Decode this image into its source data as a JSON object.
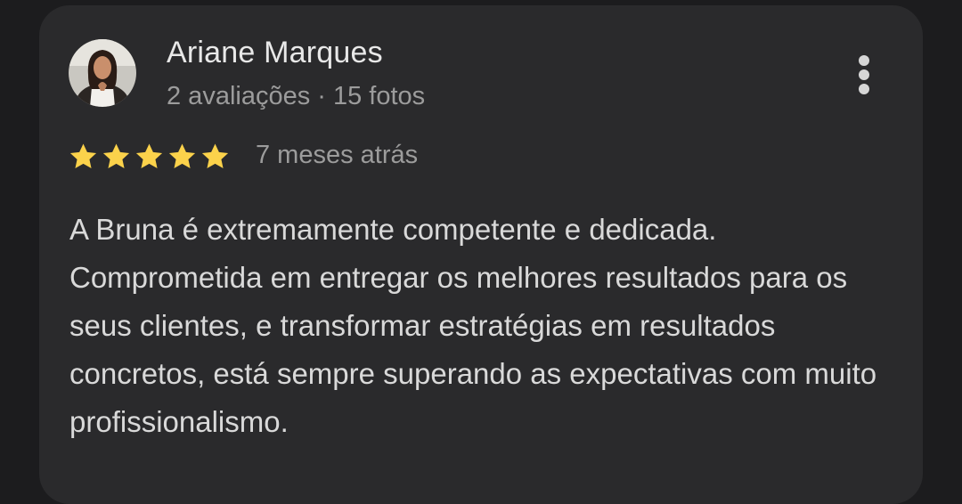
{
  "review": {
    "author_name": "Ariane Marques",
    "author_meta": "2 avaliações · 15 fotos",
    "avatar_icon": "user-avatar-photo",
    "menu_icon": "more-vert-icon",
    "rating": 5,
    "rating_max": 5,
    "star_color": "#fbd24b",
    "relative_time": "7 meses atrás",
    "text": "A Bruna é extremamente competente e dedicada. Comprometida em entregar os melhores resultados para os seus clientes, e transformar estratégias em resultados concretos, está sempre superando as expectativas com muito profissionalismo."
  }
}
